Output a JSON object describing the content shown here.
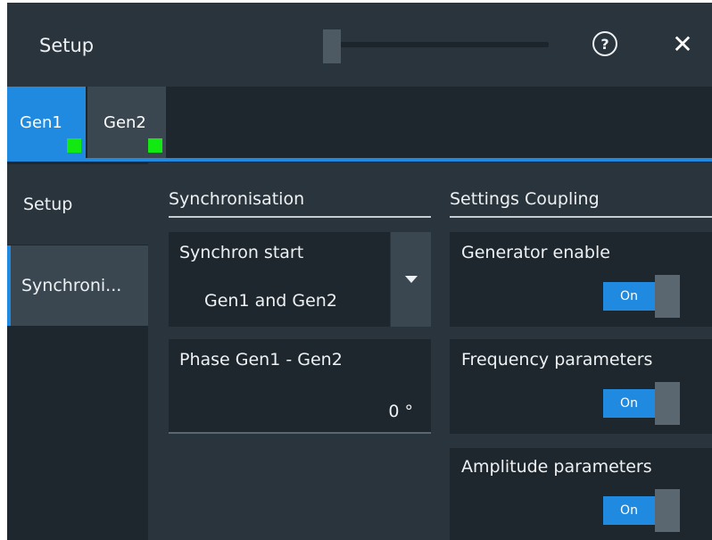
{
  "window": {
    "title": "Setup",
    "help_icon": "help-circle-icon",
    "close_icon": "close-icon",
    "help_glyph": "?",
    "close_glyph": "✕"
  },
  "tabs": [
    {
      "label": "Gen1",
      "active": true,
      "indicator_color": "#12e812"
    },
    {
      "label": "Gen2",
      "active": false,
      "indicator_color": "#12e812"
    }
  ],
  "sidenav": {
    "items": [
      {
        "label": "Setup",
        "active": false
      },
      {
        "label": "Synchroni...",
        "active": true
      }
    ]
  },
  "synchronisation": {
    "title": "Synchronisation",
    "synchron_start": {
      "label": "Synchron start",
      "value": "Gen1 and Gen2"
    },
    "phase": {
      "label": "Phase Gen1 - Gen2",
      "value": "0 °"
    }
  },
  "settings_coupling": {
    "title": "Settings Coupling",
    "generator_enable": {
      "label": "Generator enable",
      "state": "On"
    },
    "frequency_parameters": {
      "label": "Frequency parameters",
      "state": "On"
    },
    "amplitude_parameters": {
      "label": "Amplitude parameters",
      "state": "On"
    }
  },
  "colors": {
    "accent": "#1f8ae0",
    "indicator": "#12e812",
    "background": "#2a343c",
    "panel": "#1e272d"
  }
}
